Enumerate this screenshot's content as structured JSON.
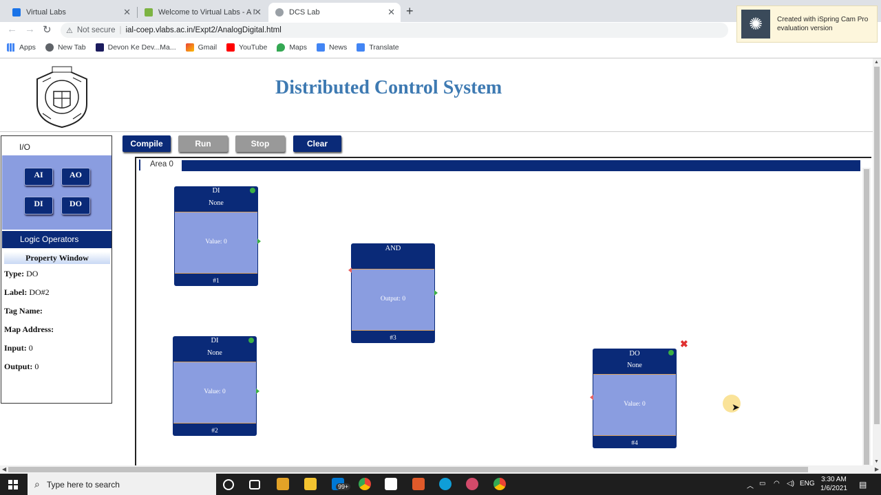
{
  "browser": {
    "tabs": [
      {
        "label": "Virtual Labs",
        "active": false
      },
      {
        "label": "Welcome to Virtual Labs - A MHR",
        "active": false
      },
      {
        "label": "DCS Lab",
        "active": true
      }
    ],
    "address": {
      "security": "Not secure",
      "url": "ial-coep.vlabs.ac.in/Expt2/AnalogDigital.html"
    },
    "bookmarks": [
      "Apps",
      "New Tab",
      "Devon Ke Dev...Ma...",
      "Gmail",
      "YouTube",
      "Maps",
      "News",
      "Translate"
    ]
  },
  "watermark": {
    "line1": "Created with iSpring Cam Pro",
    "line2": "evaluation version"
  },
  "page": {
    "title": "Distributed Control System",
    "io": {
      "title": "I/O",
      "buttons": [
        "AI",
        "AO",
        "DI",
        "DO"
      ],
      "logic_label": "Logic Operators"
    },
    "property_window": {
      "title": "Property Window",
      "rows": [
        {
          "label": "Type:",
          "value": "DO"
        },
        {
          "label": "Label:",
          "value": "DO#2"
        },
        {
          "label": "Tag Name:",
          "value": ""
        },
        {
          "label": "Map Address:",
          "value": ""
        },
        {
          "label": "Input:",
          "value": "0"
        },
        {
          "label": "Output:",
          "value": "0"
        }
      ]
    },
    "actions": {
      "compile": "Compile",
      "run": "Run",
      "stop": "Stop",
      "clear": "Clear"
    },
    "area": {
      "label": "Area 0"
    },
    "blocks": [
      {
        "title": "DI",
        "sub": "None",
        "value": "Value: 0",
        "footer": "#1"
      },
      {
        "title": "DI",
        "sub": "None",
        "value": "Value: 0",
        "footer": "#2"
      },
      {
        "title": "AND",
        "sub": "",
        "value": "Output: 0",
        "footer": "#3"
      },
      {
        "title": "DO",
        "sub": "None",
        "value": "Value: 0",
        "footer": "#4"
      }
    ]
  },
  "taskbar": {
    "search_placeholder": "Type here to search",
    "mail_badge": "99+",
    "language": "ENG",
    "time": "3:30 AM",
    "date": "1/6/2021"
  }
}
